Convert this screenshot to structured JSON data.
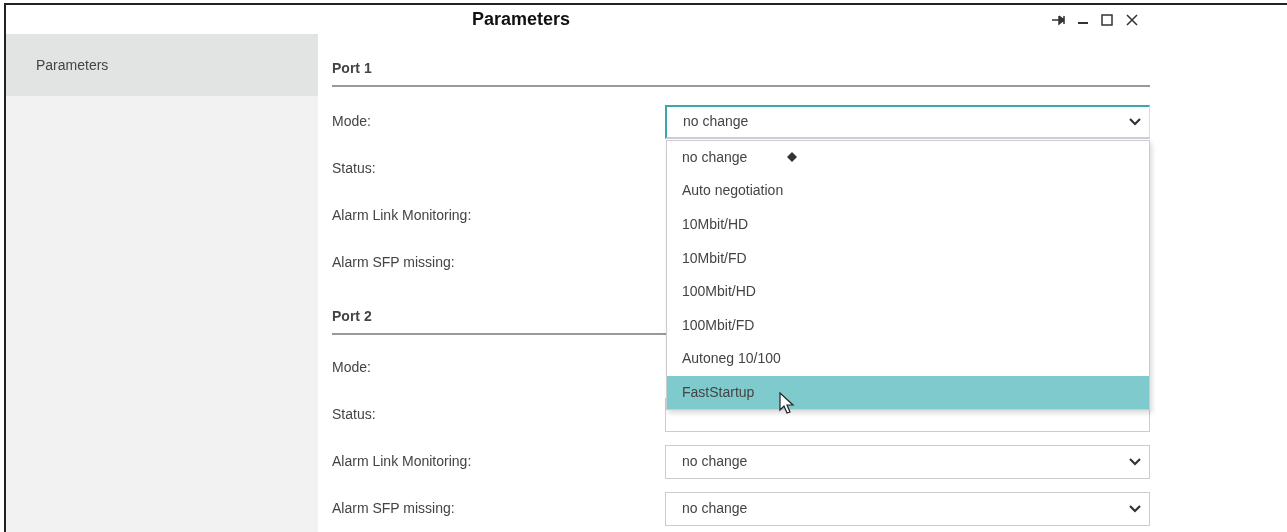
{
  "window": {
    "title": "Parameters",
    "controls": [
      {
        "kind": "pin"
      },
      {
        "kind": "minimize"
      },
      {
        "kind": "maximize"
      },
      {
        "kind": "close"
      }
    ]
  },
  "sidebar": {
    "items": [
      {
        "label": "Parameters",
        "selected": true
      }
    ]
  },
  "sections": [
    {
      "title": "Port 1",
      "fields": [
        {
          "label": "Mode:",
          "value": "no change",
          "open": true,
          "options": [
            {
              "label": "no change",
              "selected": true,
              "highlighted": false
            },
            {
              "label": "Auto negotiation",
              "selected": false,
              "highlighted": false
            },
            {
              "label": "10Mbit/HD",
              "selected": false,
              "highlighted": false
            },
            {
              "label": "10Mbit/FD",
              "selected": false,
              "highlighted": false
            },
            {
              "label": "100Mbit/HD",
              "selected": false,
              "highlighted": false
            },
            {
              "label": "100Mbit/FD",
              "selected": false,
              "highlighted": false
            },
            {
              "label": "Autoneg 10/100",
              "selected": false,
              "highlighted": false
            },
            {
              "label": "FastStartup",
              "selected": false,
              "highlighted": true
            }
          ]
        },
        {
          "label": "Status:"
        },
        {
          "label": "Alarm Link Monitoring:"
        },
        {
          "label": "Alarm SFP missing:"
        }
      ]
    },
    {
      "title": "Port 2",
      "fields": [
        {
          "label": "Mode:"
        },
        {
          "label": "Status:",
          "covered": true
        },
        {
          "label": "Alarm Link Monitoring:",
          "value": "no change"
        },
        {
          "label": "Alarm SFP missing:",
          "value": "no change"
        }
      ]
    }
  ]
}
